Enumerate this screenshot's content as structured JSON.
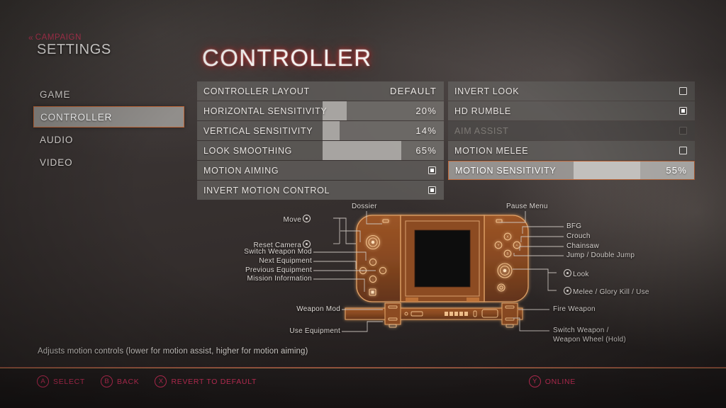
{
  "breadcrumb": {
    "chevron": "«",
    "parent": "CAMPAIGN",
    "title": "SETTINGS"
  },
  "page": {
    "title": "CONTROLLER"
  },
  "colors": {
    "accent_orange": "#c2693a",
    "accent_red": "#d6325f",
    "title_glow": "#d62e2e",
    "controller_glow": "#d07a3c"
  },
  "sidebar": {
    "items": [
      {
        "label": "GAME",
        "selected": false
      },
      {
        "label": "CONTROLLER",
        "selected": true
      },
      {
        "label": "AUDIO",
        "selected": false
      },
      {
        "label": "VIDEO",
        "selected": false
      }
    ]
  },
  "settings": {
    "left_column": [
      {
        "name": "CONTROLLER LAYOUT",
        "type": "value",
        "value": "DEFAULT",
        "highlighted": false,
        "disabled": false
      },
      {
        "name": "HORIZONTAL SENSITIVITY",
        "type": "slider",
        "value": "20%",
        "percent": 20,
        "highlighted": false,
        "disabled": false
      },
      {
        "name": "VERTICAL SENSITIVITY",
        "type": "slider",
        "value": "14%",
        "percent": 14,
        "highlighted": false,
        "disabled": false
      },
      {
        "name": "LOOK SMOOTHING",
        "type": "slider",
        "value": "65%",
        "percent": 65,
        "highlighted": false,
        "disabled": false
      },
      {
        "name": "MOTION AIMING",
        "type": "checkbox",
        "checked": true,
        "highlighted": false,
        "disabled": false
      },
      {
        "name": "INVERT MOTION CONTROL",
        "type": "checkbox",
        "checked": true,
        "highlighted": false,
        "disabled": false
      }
    ],
    "right_column": [
      {
        "name": "INVERT LOOK",
        "type": "checkbox",
        "checked": false,
        "highlighted": false,
        "disabled": false
      },
      {
        "name": "HD RUMBLE",
        "type": "checkbox",
        "checked": true,
        "highlighted": false,
        "disabled": false
      },
      {
        "name": "AIM ASSIST",
        "type": "checkbox",
        "checked": false,
        "highlighted": false,
        "disabled": true
      },
      {
        "name": "MOTION MELEE",
        "type": "checkbox",
        "checked": false,
        "highlighted": false,
        "disabled": false
      },
      {
        "name": "MOTION SENSITIVITY",
        "type": "slider",
        "value": "55%",
        "percent": 55,
        "highlighted": true,
        "disabled": false
      }
    ]
  },
  "diagram": {
    "labels": {
      "move": "Move",
      "reset_camera": "Reset Camera",
      "switch_weapon_mod": "Switch Weapon Mod",
      "next_equipment": "Next Equipment",
      "previous_equipment": "Previous Equipment",
      "mission_information": "Mission Information",
      "dossier": "Dossier",
      "pause_menu": "Pause Menu",
      "bfg": "BFG",
      "crouch": "Crouch",
      "chainsaw": "Chainsaw",
      "jump": "Jump / Double Jump",
      "look": "Look",
      "melee": "Melee / Glory Kill / Use",
      "weapon_mod": "Weapon Mod",
      "use_equipment": "Use Equipment",
      "fire_weapon": "Fire Weapon",
      "switch_weapon_1": "Switch Weapon /",
      "switch_weapon_2": "Weapon Wheel (Hold)"
    }
  },
  "footer": {
    "hint": "Adjusts motion controls (lower for motion assist, higher for motion aiming)",
    "prompts_left": [
      {
        "button": "A",
        "label": "SELECT"
      },
      {
        "button": "B",
        "label": "BACK"
      },
      {
        "button": "X",
        "label": "REVERT TO DEFAULT"
      }
    ],
    "prompts_right": [
      {
        "button": "Y",
        "label": "ONLINE"
      }
    ]
  }
}
